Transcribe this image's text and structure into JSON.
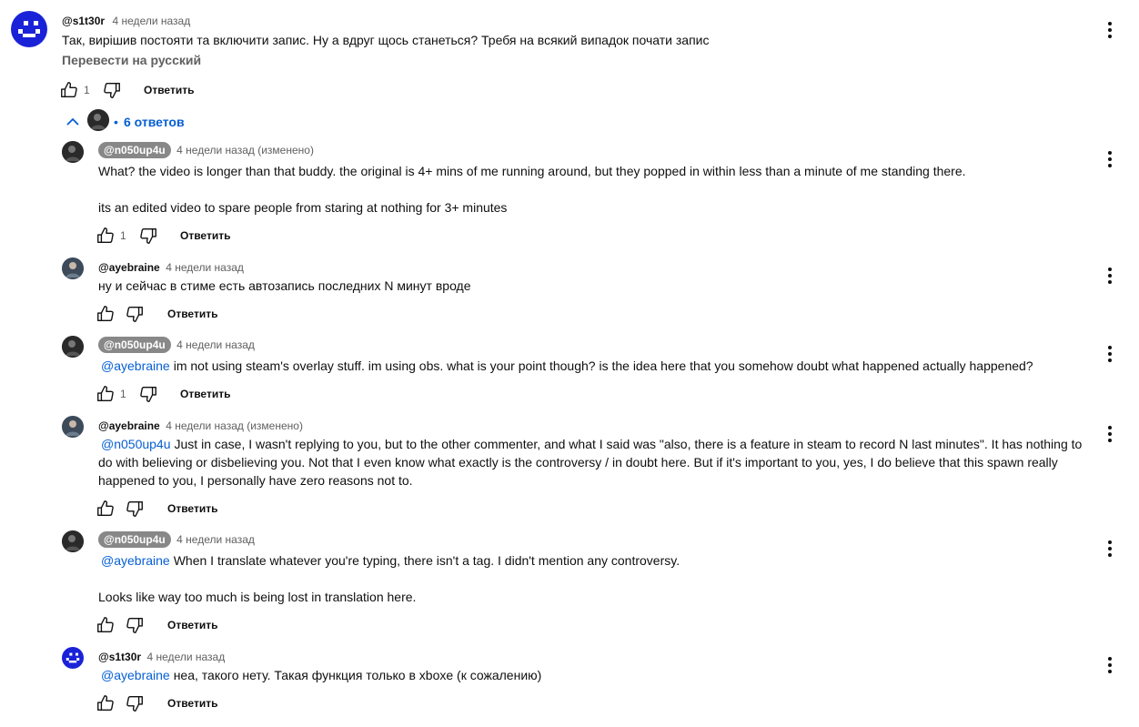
{
  "comment": {
    "author": "@s1t30r",
    "time": "4 недели назад",
    "text": "Так, вирішив постояти та включити запис. Ну а вдруг щось станеться? Требя на всякий випадок почати запис",
    "translate": "Перевести на русский",
    "likes": "1",
    "reply_label": "Ответить",
    "replies_toggle": "6 ответов"
  },
  "replies": [
    {
      "author": "@n050up4u",
      "time": "4 недели назад (изменено)",
      "line1": "What? the video is longer than that buddy. the original is 4+ mins of me running around, but they popped in within less than a minute of me standing there.",
      "line2": "its an edited video to spare people from staring at nothing for 3+ minutes",
      "likes": "1",
      "reply_label": "Ответить"
    },
    {
      "author": "@ayebraine",
      "time": "4 недели назад",
      "text": "ну и сейчас в стиме есть автозапись последних N минут вроде",
      "likes": "",
      "reply_label": "Ответить"
    },
    {
      "author": "@n050up4u",
      "time": "4 недели назад",
      "mention": "@ayebraine",
      "text": "im not using steam's overlay stuff. im using obs. what is your point though? is the idea here that you somehow doubt what happened actually happened?",
      "likes": "1",
      "reply_label": "Ответить"
    },
    {
      "author": "@ayebraine",
      "time": "4 недели назад (изменено)",
      "mention": "@n050up4u",
      "text": "Just in case, I wasn't replying to you, but to the other commenter, and what I said was \"also, there is a feature in steam to record N last minutes\". It has nothing to do with believing or disbelieving you. Not that I even know what exactly is the controversy / in doubt here. But if it's important to you, yes, I do believe that this spawn really happened to you, I personally have zero reasons not to.",
      "likes": "",
      "reply_label": "Ответить"
    },
    {
      "author": "@n050up4u",
      "time": "4 недели назад",
      "mention": "@ayebraine",
      "text": "When I translate whatever you're typing, there isn't a tag. I didn't mention any controversy.",
      "line2": "Looks like way too much is being lost in translation here.",
      "likes": "",
      "reply_label": "Ответить"
    },
    {
      "author": "@s1t30r",
      "time": "4 недели назад",
      "mention": "@ayebraine",
      "text": "неа, такого нету. Такая функция только в xboxe (к сожалению)",
      "likes": "",
      "reply_label": "Ответить"
    }
  ]
}
